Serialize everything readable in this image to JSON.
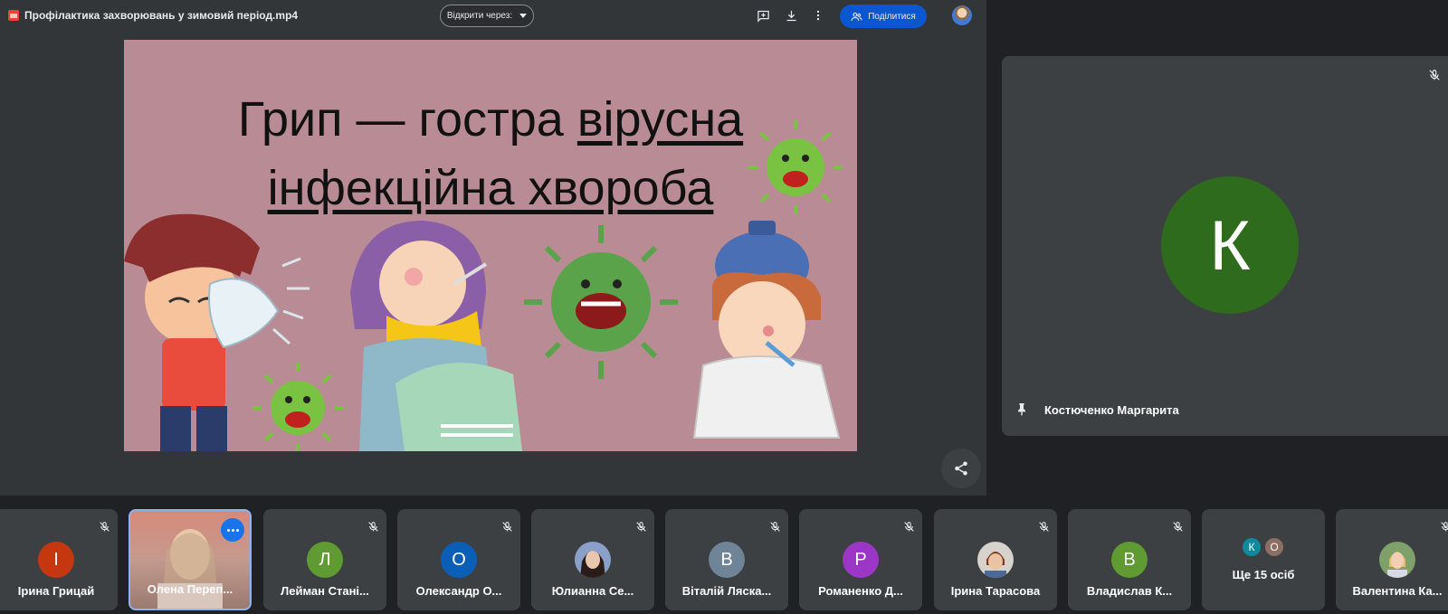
{
  "topbar": {
    "file_title": "Профілактика захворювань у зимовий період.mp4",
    "open_with_label": "Відкрити через:",
    "share_label": "Поділитися",
    "icons": [
      "add-comment-icon",
      "download-icon",
      "more-vert-icon",
      "account-avatar"
    ]
  },
  "slide": {
    "line1_plain": "Грип  — гостра ",
    "line1_underlined": "вірусна",
    "line2_underlined": "інфекційна хвороба"
  },
  "pinned": {
    "initial": "К",
    "name": "Костюченко Маргарита",
    "avatar_color": "#2e6b1c"
  },
  "participants": [
    {
      "name": "Ірина Грицай",
      "initial": "І",
      "color": "#c5380f"
    },
    {
      "name": "Олена Переп...",
      "initial": "",
      "color": ""
    },
    {
      "name": "Лейман Стані...",
      "initial": "Л",
      "color": "#5f9a32"
    },
    {
      "name": "Олександр О...",
      "initial": "О",
      "color": "#0b5eb5"
    },
    {
      "name": "Юлианна Се...",
      "initial": "",
      "color": ""
    },
    {
      "name": "Віталій Ляска...",
      "initial": "В",
      "color": "#6f8497"
    },
    {
      "name": "Романенко Д...",
      "initial": "Р",
      "color": "#9c36c7"
    },
    {
      "name": "Ірина Тарасова",
      "initial": "",
      "color": ""
    },
    {
      "name": "Владислав К...",
      "initial": "В",
      "color": "#5f9a32"
    },
    {
      "name": "Ще 15 осіб",
      "initial": "",
      "color": "",
      "mini": [
        "К",
        "О"
      ]
    },
    {
      "name": "Валентина Ка...",
      "initial": "",
      "color": ""
    }
  ],
  "colors": {
    "accent": "#0b57d0",
    "tile_bg": "#3c4043",
    "page_bg": "#202124"
  }
}
